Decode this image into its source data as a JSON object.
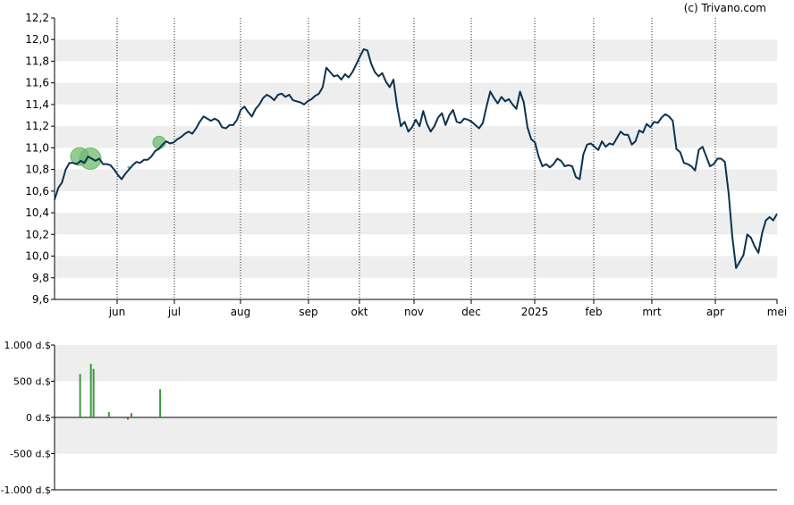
{
  "credit": "(c) Trivano.com",
  "chart_data": [
    {
      "type": "line",
      "title": "",
      "xlabel": "",
      "ylabel": "",
      "ylim": [
        9.6,
        12.2
      ],
      "yticks": [
        "12,2",
        "12,0",
        "11,8",
        "11,6",
        "11,4",
        "11,2",
        "11,0",
        "10,8",
        "10,6",
        "10,4",
        "10,2",
        "10,0",
        "9,8",
        "9,6"
      ],
      "xticks": [
        "jun",
        "jul",
        "aug",
        "sep",
        "okt",
        "nov",
        "dec",
        "2025",
        "feb",
        "mrt",
        "apr",
        "mei"
      ],
      "grid": "alternating horizontal bands, dotted vertical lines at month boundaries",
      "line_color": "#0b3350",
      "series": [
        {
          "values": [
            10.52,
            10.63,
            10.68,
            10.8,
            10.86,
            10.86,
            10.85,
            10.88,
            10.86,
            10.92,
            10.9,
            10.88,
            10.9,
            10.85,
            10.85,
            10.84,
            10.8,
            10.75,
            10.71,
            10.76,
            10.8,
            10.84,
            10.87,
            10.86,
            10.89,
            10.89,
            10.92,
            10.97,
            10.99,
            11.03,
            11.06,
            11.04,
            11.05,
            11.08,
            11.1,
            11.13,
            11.15,
            11.13,
            11.18,
            11.24,
            11.29,
            11.27,
            11.25,
            11.27,
            11.25,
            11.19,
            11.18,
            11.21,
            11.21,
            11.26,
            11.35,
            11.38,
            11.33,
            11.29,
            11.36,
            11.4,
            11.46,
            11.49,
            11.47,
            11.44,
            11.49,
            11.5,
            11.47,
            11.49,
            11.44,
            11.43,
            11.42,
            11.4,
            11.43,
            11.45,
            11.48,
            11.5,
            11.56,
            11.74,
            11.7,
            11.66,
            11.67,
            11.63,
            11.68,
            11.65,
            11.7,
            11.77,
            11.84,
            11.91,
            11.9,
            11.78,
            11.7,
            11.66,
            11.69,
            11.61,
            11.56,
            11.63,
            11.38,
            11.2,
            11.24,
            11.15,
            11.19,
            11.26,
            11.2,
            11.34,
            11.22,
            11.15,
            11.2,
            11.28,
            11.32,
            11.21,
            11.3,
            11.35,
            11.24,
            11.23,
            11.27,
            11.26,
            11.24,
            11.21,
            11.18,
            11.23,
            11.38,
            11.52,
            11.46,
            11.41,
            11.47,
            11.43,
            11.45,
            11.4,
            11.36,
            11.52,
            11.42,
            11.19,
            11.08,
            11.05,
            10.92,
            10.83,
            10.85,
            10.82,
            10.85,
            10.9,
            10.88,
            10.83,
            10.84,
            10.83,
            10.73,
            10.71,
            10.94,
            11.03,
            11.04,
            11.01,
            10.98,
            11.06,
            11.01,
            11.04,
            11.03,
            11.09,
            11.15,
            11.12,
            11.12,
            11.03,
            11.06,
            11.16,
            11.14,
            11.22,
            11.19,
            11.24,
            11.23,
            11.28,
            11.31,
            11.29,
            11.25,
            10.99,
            10.96,
            10.86,
            10.85,
            10.83,
            10.79,
            10.98,
            11.01,
            10.92,
            10.83,
            10.85,
            10.9,
            10.9,
            10.87,
            10.58,
            10.18,
            9.89,
            9.95,
            10.01,
            10.2,
            10.17,
            10.09,
            10.03,
            10.21,
            10.33,
            10.36,
            10.33,
            10.39
          ]
        }
      ],
      "markers": [
        {
          "type": "event",
          "label": "",
          "color": "#6fba6f",
          "value": 10.92
        },
        {
          "type": "event",
          "label": "",
          "color": "#6fba6f",
          "value": 10.9
        },
        {
          "type": "event",
          "label": "",
          "color": "#6fba6f",
          "value": 11.05
        }
      ]
    },
    {
      "type": "bar",
      "title": "",
      "xlabel": "",
      "ylabel": "",
      "ylim": [
        -1000,
        1000
      ],
      "yticks": [
        "1.000 d.$",
        "500 d.$",
        "0 d.$",
        "-500 d.$",
        "-1.000 d.$"
      ],
      "grid": "alternating horizontal bands",
      "positive_color": "#3a9a3a",
      "negative_color": "#d03030",
      "bars": [
        {
          "position": 0.0354,
          "value": 600
        },
        {
          "position": 0.0503,
          "value": 740
        },
        {
          "position": 0.054,
          "value": 670
        },
        {
          "position": 0.0752,
          "value": 75
        },
        {
          "position": 0.1014,
          "value": -30
        },
        {
          "position": 0.1064,
          "value": 60
        },
        {
          "position": 0.1462,
          "value": 390
        }
      ]
    }
  ]
}
